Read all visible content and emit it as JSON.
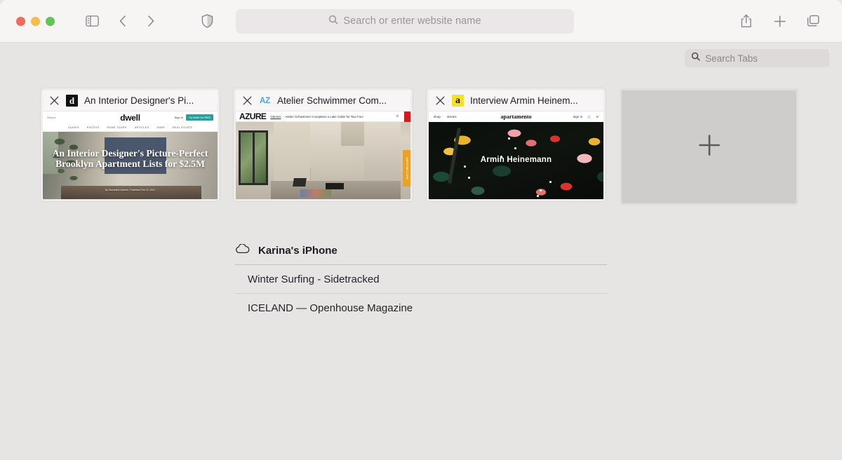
{
  "window": {
    "traffic_lights": [
      {
        "name": "close",
        "color": "#ee6a5f"
      },
      {
        "name": "minimize",
        "color": "#f5bd4f"
      },
      {
        "name": "zoom",
        "color": "#61c454"
      }
    ]
  },
  "toolbar": {
    "sidebar_icon": "sidebar-icon",
    "back_icon": "chevron-left-icon",
    "forward_icon": "chevron-right-icon",
    "shield_icon": "shield-icon",
    "address_placeholder": "Search or enter website name",
    "address_value": "",
    "share_icon": "share-icon",
    "new_tab_icon": "plus-icon",
    "tab_overview_icon": "tab-overview-icon"
  },
  "search_tabs": {
    "placeholder": "Search Tabs",
    "value": "",
    "icon": "search-icon"
  },
  "tabs": [
    {
      "title": "An Interior Designer's Pi...",
      "favicon_letter": "d",
      "favicon_style": "dwell",
      "close_icon": "close-icon",
      "site": "dwell",
      "preview": {
        "logo": "dwell",
        "search_label": "Search",
        "signin_label": "Sign In",
        "cta_label": "Try Dwell+ for FREE",
        "nav": [
          "GUIDES",
          "PHOTOS",
          "HOME TOURS",
          "ARTICLES",
          "SHOP",
          "REAL ESTATE"
        ],
        "headline": "An Interior Designer's Picture-Perfect Brooklyn Apartment Lists for $2.5M",
        "byline": "By Samantha Daniels / Published Feb 22, 2021"
      }
    },
    {
      "title": "Atelier Schwimmer Com...",
      "favicon_letter": "AZ",
      "favicon_style": "azure",
      "close_icon": "close-icon",
      "site": "azure",
      "preview": {
        "logo": "AZURE",
        "section": "Interiors",
        "headline": "Atelier Schwimmer Completes a Lake Cabin for Two Fun-",
        "search_icon": "search-icon",
        "side_tab_label": "SUBSCRIBE & SAVE"
      }
    },
    {
      "title": "Interview Armin Heinem...",
      "favicon_letter": "a",
      "favicon_style": "apartamento",
      "close_icon": "close-icon",
      "site": "apartamento",
      "preview": {
        "logo": "apartamento",
        "nav_left": [
          "shop",
          "stories"
        ],
        "signin_label": "sign in",
        "cart_icon": "cart-icon",
        "search_icon": "search-icon",
        "hero_title": "Armin Heinemann"
      }
    }
  ],
  "new_tab_card": {
    "icon": "plus-icon",
    "label": ""
  },
  "icloud_tabs": {
    "device_name": "Karina's iPhone",
    "cloud_icon": "cloud-icon",
    "items": [
      {
        "title": "Winter Surfing - Sidetracked"
      },
      {
        "title": "ICELAND — Openhouse Magazine"
      }
    ]
  }
}
